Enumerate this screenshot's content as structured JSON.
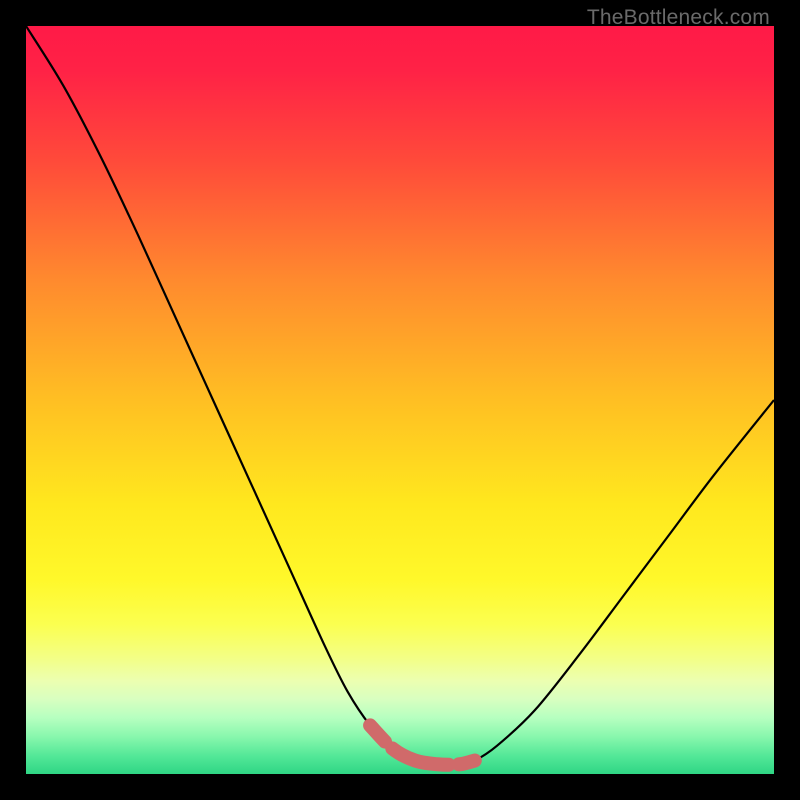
{
  "watermark": "TheBottleneck.com",
  "colors": {
    "frame": "#000000",
    "watermark": "#6a6a6a",
    "curve": "#000000",
    "highlight": "#d06a6a",
    "gradient_stops": [
      {
        "offset": 0.0,
        "color": "#ff1a47"
      },
      {
        "offset": 0.06,
        "color": "#ff2246"
      },
      {
        "offset": 0.18,
        "color": "#ff4a3a"
      },
      {
        "offset": 0.34,
        "color": "#ff8a2e"
      },
      {
        "offset": 0.5,
        "color": "#ffbf23"
      },
      {
        "offset": 0.64,
        "color": "#ffe81e"
      },
      {
        "offset": 0.74,
        "color": "#fff82a"
      },
      {
        "offset": 0.8,
        "color": "#fbff50"
      },
      {
        "offset": 0.845,
        "color": "#f3ff86"
      },
      {
        "offset": 0.875,
        "color": "#ecffb0"
      },
      {
        "offset": 0.9,
        "color": "#d8ffc0"
      },
      {
        "offset": 0.925,
        "color": "#b6ffc0"
      },
      {
        "offset": 0.95,
        "color": "#88f7ad"
      },
      {
        "offset": 0.975,
        "color": "#55e898"
      },
      {
        "offset": 1.0,
        "color": "#2fd685"
      }
    ]
  },
  "chart_data": {
    "type": "line",
    "title": "",
    "xlabel": "",
    "ylabel": "",
    "xlim": [
      0,
      100
    ],
    "ylim": [
      0,
      100
    ],
    "grid": false,
    "series": [
      {
        "name": "bottleneck-curve",
        "x": [
          0,
          5,
          10,
          15,
          20,
          25,
          30,
          35,
          40,
          43,
          46,
          49,
          52,
          55,
          58,
          60,
          63,
          68,
          74,
          80,
          86,
          92,
          100
        ],
        "y": [
          100,
          92,
          82.5,
          72,
          61,
          50,
          39,
          28,
          17,
          11,
          6.5,
          3.4,
          1.8,
          1.3,
          1.3,
          1.8,
          3.8,
          8.5,
          16,
          24,
          32,
          40,
          50
        ]
      }
    ],
    "highlight_region": {
      "x_start": 46,
      "x_end": 60
    },
    "annotations": []
  }
}
